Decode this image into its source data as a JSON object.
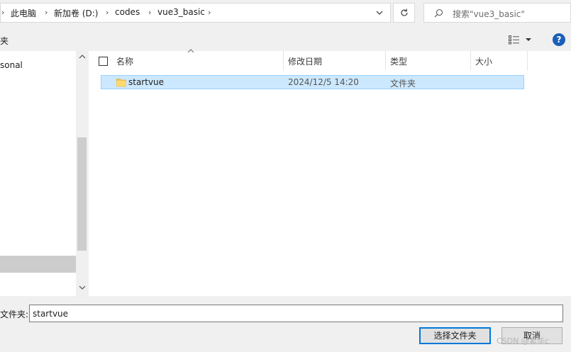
{
  "breadcrumb": {
    "items": [
      "此电脑",
      "新加卷 (D:)",
      "codes",
      "vue3_basic"
    ]
  },
  "search": {
    "placeholder": "搜索\"vue3_basic\""
  },
  "toolbar": {
    "new_folder_label": "夹"
  },
  "help": {
    "label": "?"
  },
  "nav": {
    "items": [
      {
        "label": "sonal"
      }
    ]
  },
  "filelist": {
    "columns": [
      "名称",
      "修改日期",
      "类型",
      "大小"
    ],
    "rows": [
      {
        "name": "startvue",
        "modified": "2024/12/5 14:20",
        "type": "文件夹",
        "size": ""
      }
    ]
  },
  "footer": {
    "filename_label": "文件夹:",
    "filename_value": "startvue",
    "select_button": "选择文件夹",
    "cancel_button": "取消"
  },
  "watermark": "CSDN @素华c",
  "icons": {
    "breadcrumb_separator": "chevron-right-icon",
    "address_dropdown": "chevron-down-icon",
    "refresh": "refresh-icon",
    "search": "search-icon",
    "view": "view-options-icon",
    "help": "help-icon",
    "folder": "folder-icon"
  },
  "colors": {
    "selection_bg": "#cce8ff",
    "selection_border": "#99d1ff",
    "accent": "#0078d7",
    "help_bg": "#1c5fb8"
  }
}
